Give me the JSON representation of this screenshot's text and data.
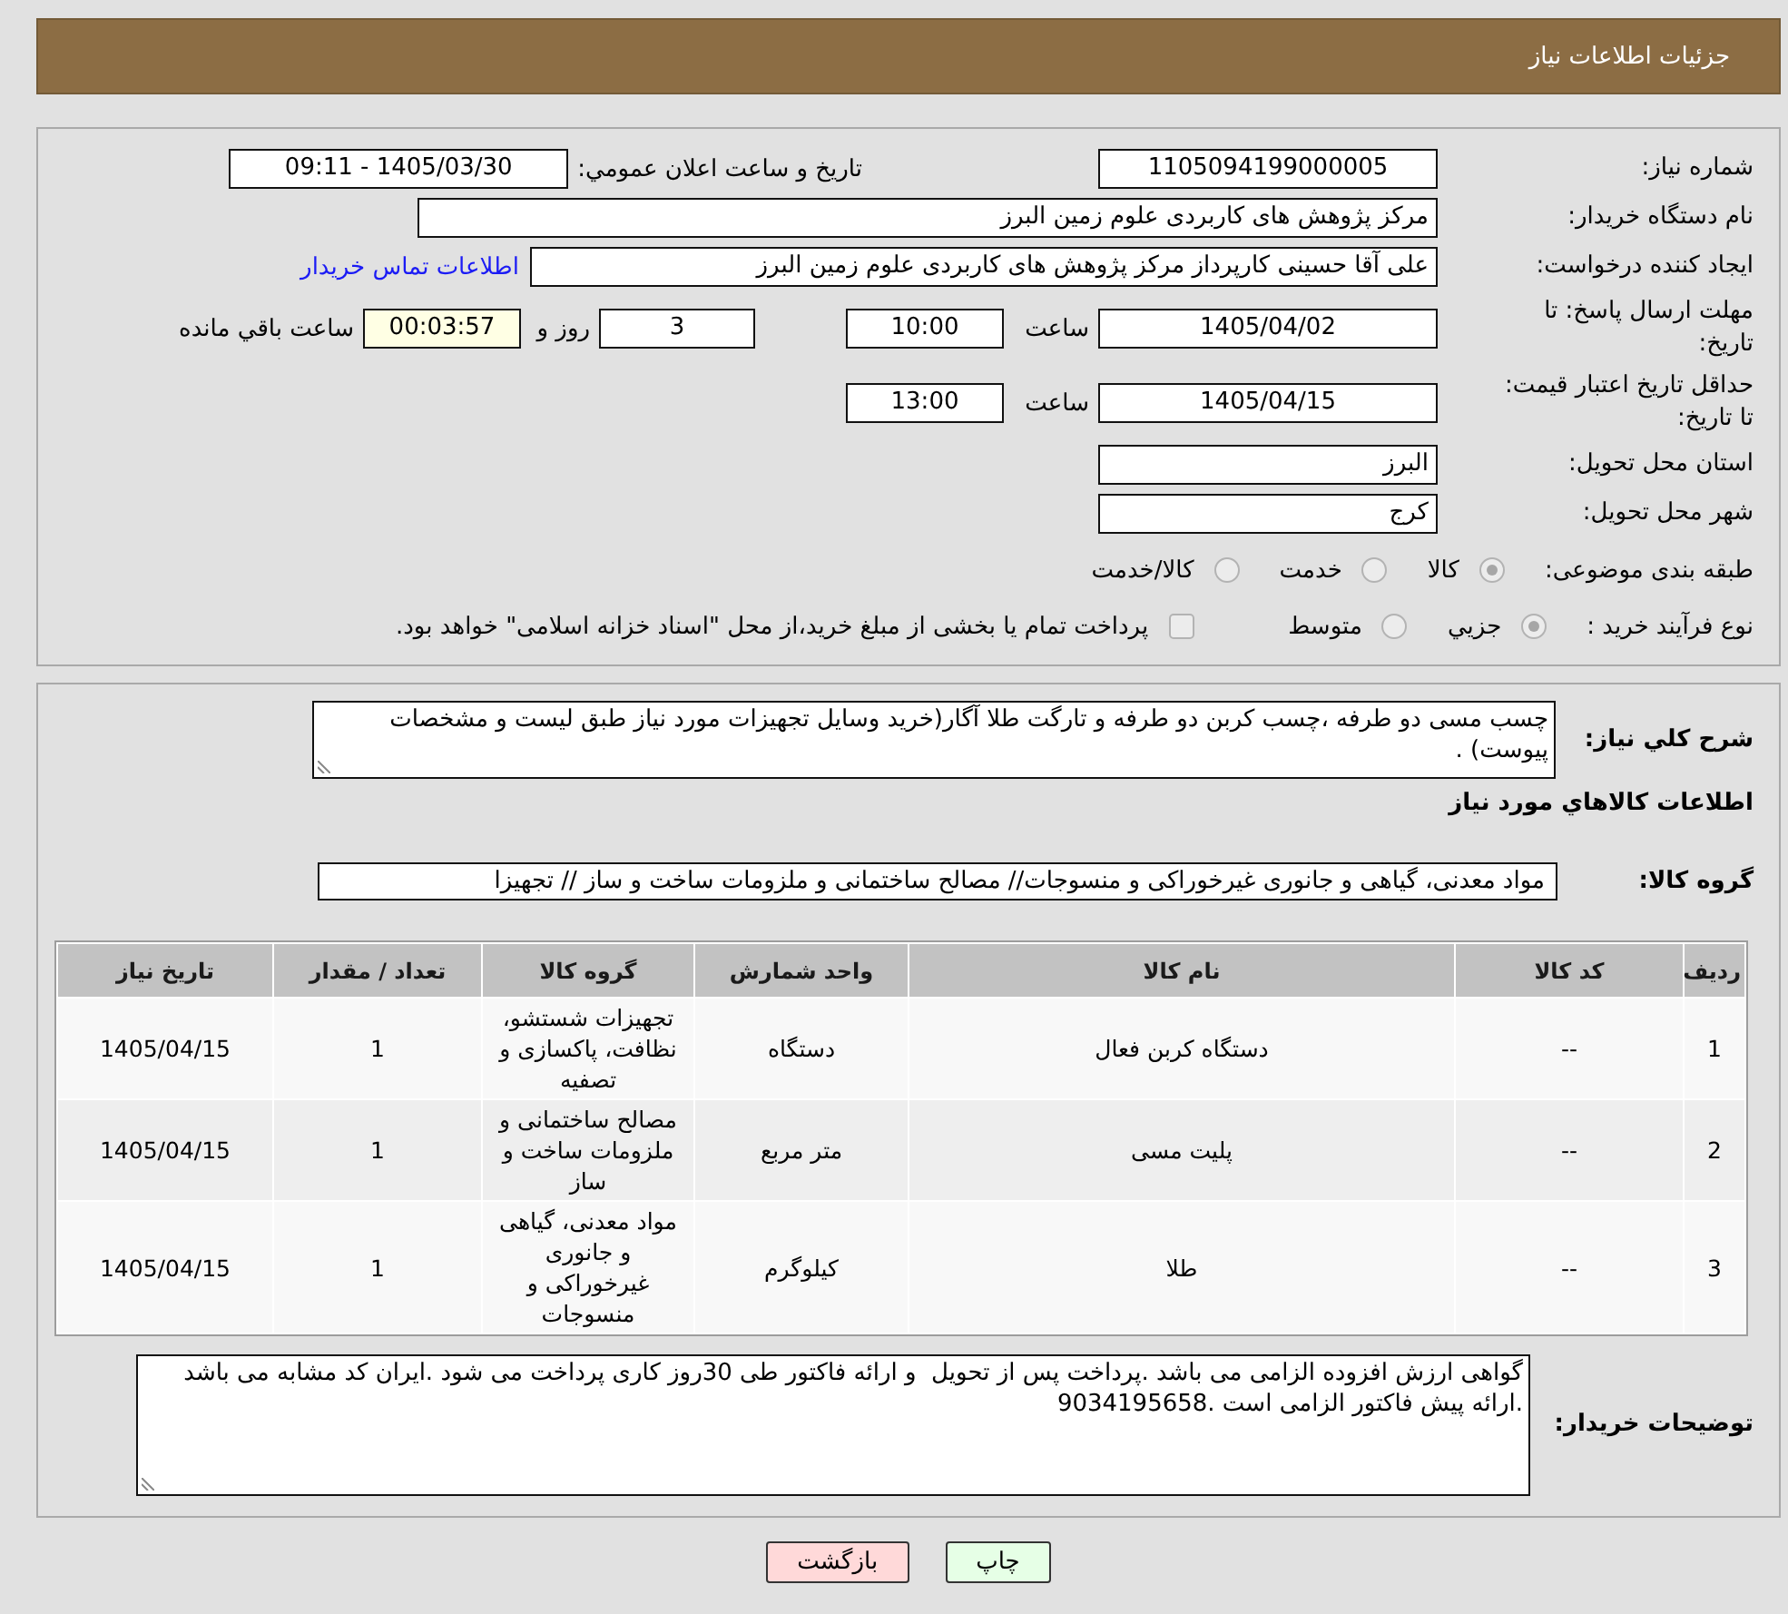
{
  "header": {
    "title": "جزئیات اطلاعات نیاز"
  },
  "need_info": {
    "need_number": {
      "label": "شماره نیاز:",
      "value": "1105094199000005"
    },
    "announce_date": {
      "label": "تاریخ و ساعت اعلان عمومي:",
      "value": "1405/03/30 - 09:11"
    },
    "buyer_org": {
      "label": "نام دستگاه خریدار:",
      "value": "مرکز پژوهش های کاربردی علوم زمین البرز"
    },
    "requester": {
      "label": "ایجاد کننده درخواست:",
      "value": "علی آقا حسینی کارپرداز مرکز پژوهش های کاربردی علوم زمین البرز",
      "contact_link": "اطلاعات تماس خریدار"
    },
    "reply_deadline": {
      "label": "مهلت ارسال پاسخ: تا تاریخ:",
      "date": "1405/04/02",
      "time_label": "ساعت",
      "time": "10:00",
      "days": "3",
      "days_label": "روز و",
      "remaining": "00:03:57",
      "remaining_label": "ساعت باقي مانده"
    },
    "price_validity": {
      "label": "حداقل تاریخ اعتبار قیمت: تا تاریخ:",
      "date": "1405/04/15",
      "time_label": "ساعت",
      "time": "13:00"
    },
    "delivery_province": {
      "label": "استان محل تحویل:",
      "value": "البرز"
    },
    "delivery_city": {
      "label": "شهر محل تحویل:",
      "value": "کرج"
    },
    "subject_category": {
      "label": "طبقه بندی موضوعی:",
      "options": [
        {
          "label": "کالا",
          "selected": true,
          "disabled": true
        },
        {
          "label": "خدمت",
          "selected": false,
          "disabled": true
        },
        {
          "label": "کالا/خدمت",
          "selected": false,
          "disabled": true
        }
      ]
    },
    "purchase_process": {
      "label": "نوع فرآیند خرید :",
      "options": [
        {
          "label": "جزيي",
          "selected": true,
          "disabled": true
        },
        {
          "label": "متوسط",
          "selected": false,
          "disabled": true
        }
      ],
      "treasury_payment": {
        "label": "پرداخت تمام یا بخشی از مبلغ خرید،از محل \"اسناد خزانه اسلامی\" خواهد بود.",
        "checked": false,
        "disabled": true
      }
    }
  },
  "items_info": {
    "description": {
      "label": "شرح كلي نياز:",
      "value": "چسب مسی دو طرفه ،چسب کربن دو طرفه و تارگت طلا آگار(خرید وسایل تجهیزات مورد نیاز طبق لیست و مشخصات پیوست) ."
    },
    "heading": "اطلاعات كالاهاي مورد نياز",
    "goods_group": {
      "label": "گروه کالا:",
      "value": "مواد معدنی، گیاهی و جانوری غیرخوراکی و منسوجات// مصالح ساختمانی و ملزومات ساخت و ساز // تجهیزا"
    },
    "table": {
      "columns": [
        "ردیف",
        "کد کالا",
        "نام کالا",
        "واحد شمارش",
        "گروه کالا",
        "تعداد / مقدار",
        "تاریخ نیاز"
      ],
      "rows": [
        [
          "1",
          "--",
          "دستگاه کربن فعال",
          "دستگاه",
          "تجهیزات شستشو، نظافت، پاکسازی و تصفیه",
          "1",
          "1405/04/15"
        ],
        [
          "2",
          "--",
          "پلیت مسی",
          "متر مربع",
          "مصالح ساختمانی و ملزومات ساخت و ساز",
          "1",
          "1405/04/15"
        ],
        [
          "3",
          "--",
          "طلا",
          "کیلوگرم",
          "مواد معدنی، گیاهی و جانوری غیرخوراکی و منسوجات",
          "1",
          "1405/04/15"
        ]
      ]
    },
    "buyer_notes": {
      "label": "توضیحات خریدار:",
      "value": "گواهی ارزش افزوده الزامی می باشد .پرداخت پس از تحویل  و ارائه فاکتور طی 30روز کاری پرداخت می شود .ایران کد مشابه می باشد .ارائه پیش فاکتور الزامی است .9034195658"
    }
  },
  "buttons": [
    {
      "label": "چاپ",
      "kind": "print"
    },
    {
      "label": "بازگشت",
      "kind": "back"
    }
  ]
}
